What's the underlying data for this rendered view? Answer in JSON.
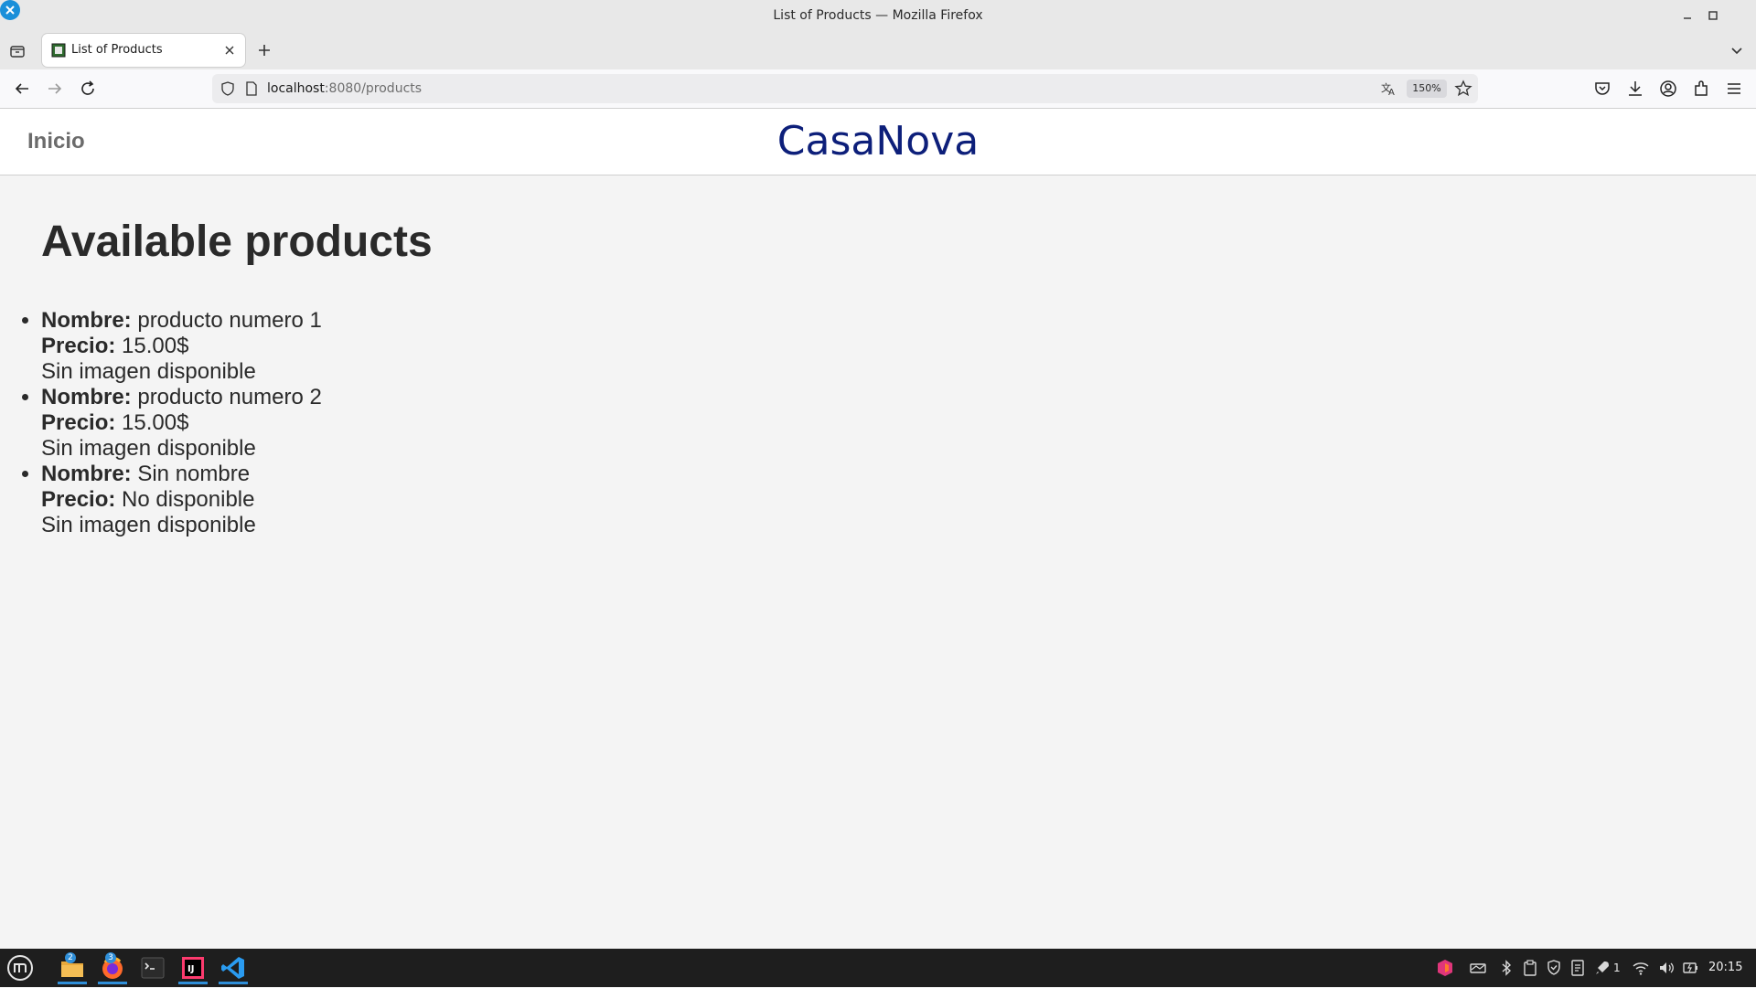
{
  "window": {
    "title": "List of Products — Mozilla Firefox"
  },
  "tabs": [
    {
      "label": "List of Products",
      "active": true
    }
  ],
  "address_bar": {
    "host": "localhost",
    "rest": ":8080/products",
    "zoom": "150%"
  },
  "site": {
    "nav_inicio": "Inicio",
    "brand": "CasaNova",
    "brand_color": "#0d1f7a",
    "heading": "Available products",
    "name_label": "Nombre:",
    "price_label": "Precio:",
    "products": [
      {
        "name": "producto numero 1",
        "price": "15.00$",
        "image": "Sin imagen disponible"
      },
      {
        "name": "producto numero 2",
        "price": "15.00$",
        "image": "Sin imagen disponible"
      },
      {
        "name": "Sin nombre",
        "price": "No disponible",
        "image": "Sin imagen disponible"
      }
    ]
  },
  "taskbar": {
    "apps": [
      {
        "name": "files",
        "badge": "2"
      },
      {
        "name": "firefox",
        "badge": "3"
      },
      {
        "name": "terminal"
      },
      {
        "name": "intellij"
      },
      {
        "name": "vscode"
      }
    ],
    "tray_count": "1",
    "clock": "20:15",
    "accent": "#2f8fd9"
  }
}
